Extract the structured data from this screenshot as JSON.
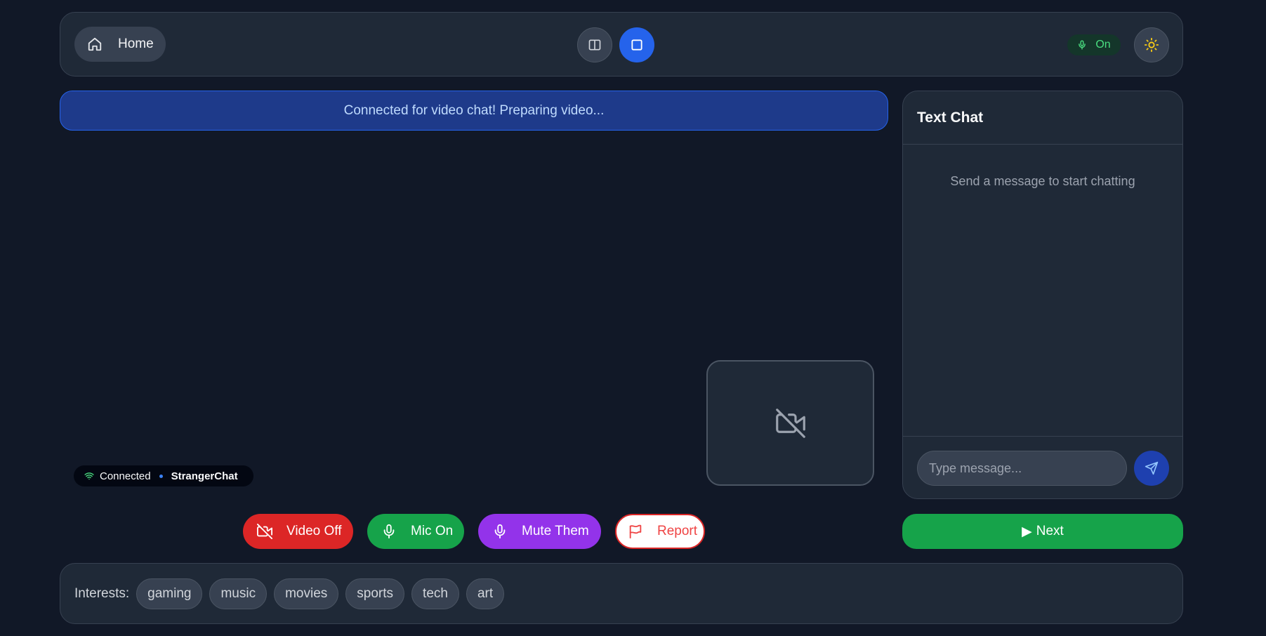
{
  "colors": {
    "background": "#111827",
    "panel": "#1f2937",
    "accent_blue": "#2563eb",
    "danger": "#dc2626",
    "success": "#16a34a",
    "purple": "#9333ea"
  },
  "header": {
    "home_label": "Home",
    "home_icon": "home-icon",
    "layout_split_icon": "split-view-icon",
    "layout_single_icon": "single-view-icon",
    "mic_status": "On",
    "mic_icon": "mic-icon",
    "theme_icon": "sun-icon"
  },
  "banner": {
    "text": "Connected for video chat! Preparing video..."
  },
  "video": {
    "self_view_icon": "video-off-icon",
    "connection_status": "Connected",
    "brand": "StrangerChat"
  },
  "controls": {
    "video": "Video Off",
    "mic": "Mic On",
    "mute": "Mute Them",
    "report": "Report"
  },
  "chat": {
    "title": "Text Chat",
    "empty_text": "Send a message to start chatting",
    "input_placeholder": "Type message...",
    "send_icon": "send-icon"
  },
  "next": {
    "label": "Next"
  },
  "interests": {
    "label": "Interests:",
    "tags": [
      "gaming",
      "music",
      "movies",
      "sports",
      "tech",
      "art"
    ]
  }
}
